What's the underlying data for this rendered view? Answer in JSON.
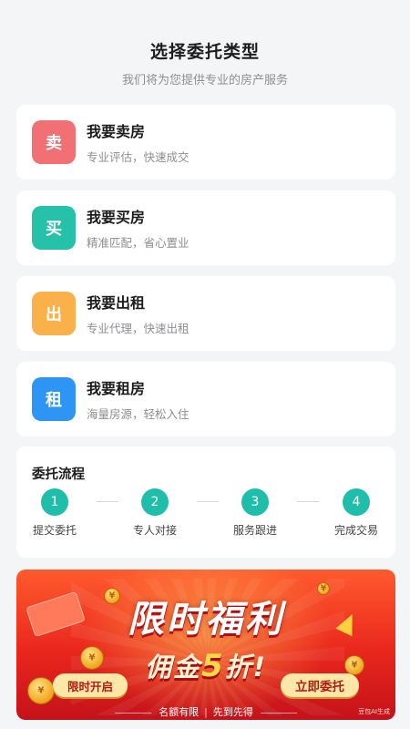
{
  "header": {
    "title": "选择委托类型",
    "subtitle": "我们将为您提供专业的房产服务"
  },
  "types": [
    {
      "badge": "卖",
      "title": "我要卖房",
      "desc": "专业评估，快速成交",
      "color": "#f17074"
    },
    {
      "badge": "买",
      "title": "我要买房",
      "desc": "精准匹配，省心置业",
      "color": "#25c2a9"
    },
    {
      "badge": "出",
      "title": "我要出租",
      "desc": "专业代理，快速出租",
      "color": "#fbb14a"
    },
    {
      "badge": "租",
      "title": "我要租房",
      "desc": "海量房源，轻松入住",
      "color": "#2e95f4"
    }
  ],
  "flow": {
    "title": "委托流程",
    "steps": [
      {
        "num": "1",
        "label": "提交委托"
      },
      {
        "num": "2",
        "label": "专人对接"
      },
      {
        "num": "3",
        "label": "服务跟进"
      },
      {
        "num": "4",
        "label": "完成交易"
      }
    ]
  },
  "banner": {
    "headline": "限时福利",
    "sub_prefix": "佣金",
    "sub_number": "5",
    "sub_suffix": "折!",
    "left_pill": "限时开启",
    "cta": "立即委托",
    "foot_a": "名额有限",
    "foot_b": "先到先得",
    "ai_mark": "豆包AI生成"
  }
}
